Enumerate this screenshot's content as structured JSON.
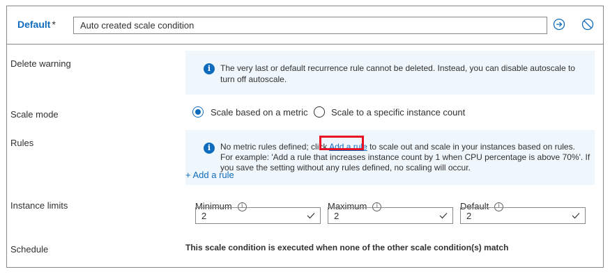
{
  "header": {
    "title": "Default",
    "required_marker": "*",
    "condition_name": "Auto created scale condition",
    "navigate_icon": "arrow-right-circle-icon",
    "disable_icon": "prohibited-icon"
  },
  "delete_warning": {
    "label": "Delete warning",
    "message_line1": "The very last or default recurrence rule cannot be deleted. Instead, you can disable autoscale to",
    "message_line2": "turn off autoscale."
  },
  "scale_mode": {
    "label": "Scale mode",
    "options": [
      {
        "label": "Scale based on a metric",
        "selected": true
      },
      {
        "label": "Scale to a specific instance count",
        "selected": false
      }
    ]
  },
  "rules": {
    "label": "Rules",
    "line1_before": "No metric rules defined; click ",
    "line1_link": "Add a rule",
    "line1_after": " to scale out and scale in your instances based on rules.",
    "line2": "For example: 'Add a rule that increases instance count by 1 when CPU percentage is above 70%'. If",
    "line3": "you save the setting without any rules defined, no scaling will occur.",
    "add_rule_label": "+ Add a rule"
  },
  "instance_limits": {
    "label": "Instance limits",
    "minimum": {
      "label": "Minimum",
      "value": "2"
    },
    "maximum": {
      "label": "Maximum",
      "value": "2"
    },
    "default": {
      "label": "Default",
      "value": "2"
    }
  },
  "schedule": {
    "label": "Schedule",
    "text": "This scale condition is executed when none of the other scale condition(s) match"
  },
  "colors": {
    "accent": "#0f6cbd",
    "info_background": "#eff6fc",
    "highlight": "#e81123"
  }
}
